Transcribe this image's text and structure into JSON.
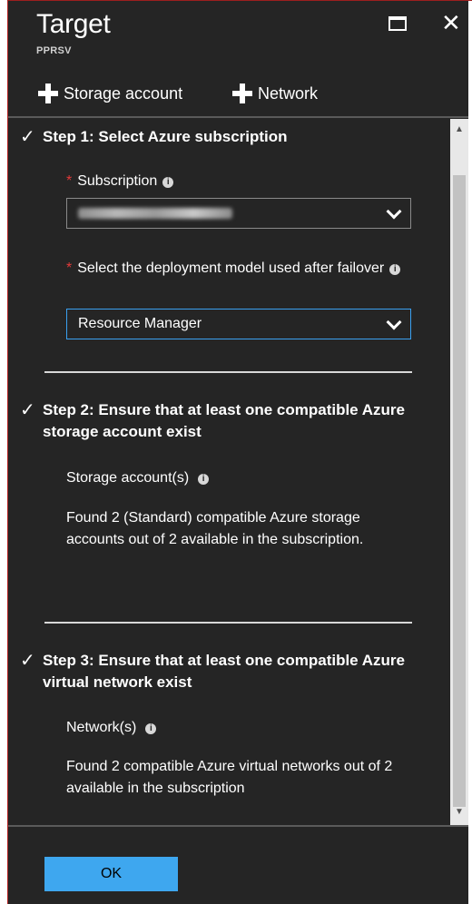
{
  "header": {
    "title": "Target",
    "subtitle": "PPRSV"
  },
  "commands": {
    "storage_account": "Storage account",
    "network": "Network"
  },
  "step1": {
    "check": "✓",
    "heading": "Step 1: Select Azure subscription",
    "required_mark": "*",
    "subscription_label": "Subscription",
    "info_icon": "i",
    "subscription_value_obscured": true,
    "deployment_label": "Select the deployment model used after failover",
    "deployment_value": "Resource Manager"
  },
  "step2": {
    "check": "✓",
    "heading": "Step 2: Ensure that at least one compatible Azure storage account exist",
    "field_label": "Storage account(s)",
    "info_icon": "i",
    "message": "Found 2 (Standard) compatible Azure storage accounts out of 2 available in the subscription."
  },
  "step3": {
    "check": "✓",
    "heading": "Step 3: Ensure that at least one compatible Azure virtual network exist",
    "field_label": "Network(s)",
    "info_icon": "i",
    "message": "Found 2 compatible Azure virtual networks out of 2 available in the subscription"
  },
  "footer": {
    "ok_label": "OK"
  },
  "icons": {
    "maximize": "maximize-icon",
    "close": "close-icon",
    "plus": "plus-icon",
    "check": "check-icon",
    "info": "info-icon",
    "chevron": "chevron-down-icon"
  },
  "colors": {
    "background": "#252525",
    "accent": "#3ea7ef",
    "required": "#e23a3a"
  }
}
